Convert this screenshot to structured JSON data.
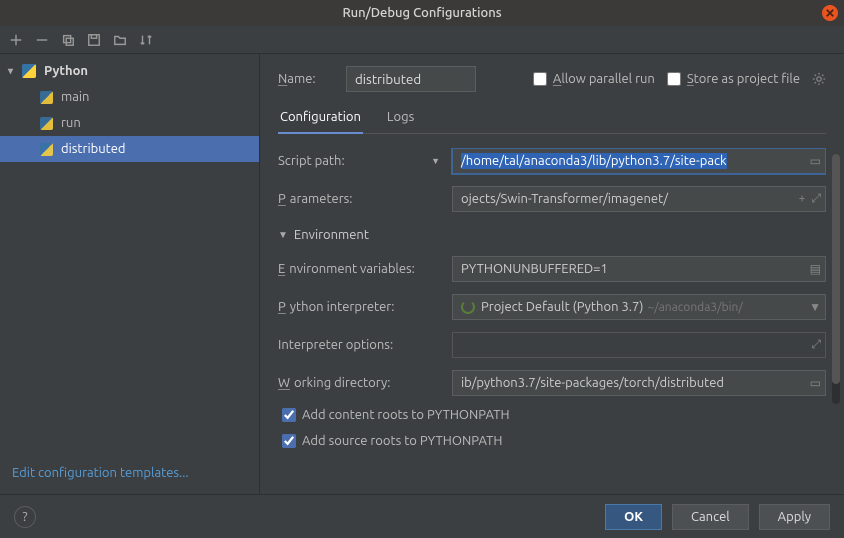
{
  "window": {
    "title": "Run/Debug Configurations"
  },
  "sidebar": {
    "root": {
      "label": "Python"
    },
    "items": [
      {
        "label": "main"
      },
      {
        "label": "run"
      },
      {
        "label": "distributed",
        "selected": true
      }
    ],
    "edit_templates": "Edit configuration templates..."
  },
  "header": {
    "name_label": "Name:",
    "name_value": "distributed",
    "allow_parallel": "Allow parallel run",
    "store_project": "Store as project file"
  },
  "tabs": {
    "configuration": "Configuration",
    "logs": "Logs"
  },
  "form": {
    "script_path_label": "Script path:",
    "script_path_value": "/home/tal/anaconda3/lib/python3.7/site-pack",
    "parameters_label": "Parameters:",
    "parameters_value": "ojects/Swin-Transformer/imagenet/",
    "env_section": "Environment",
    "env_vars_label": "Environment variables:",
    "env_vars_value": "PYTHONUNBUFFERED=1",
    "interpreter_label": "Python interpreter:",
    "interpreter_value": "Project Default (Python 3.7)",
    "interpreter_hint": "~/anaconda3/bin/",
    "interpreter_opts_label": "Interpreter options:",
    "interpreter_opts_value": "",
    "workdir_label": "Working directory:",
    "workdir_value": "ib/python3.7/site-packages/torch/distributed",
    "add_content_roots": "Add content roots to PYTHONPATH",
    "add_source_roots": "Add source roots to PYTHONPATH"
  },
  "buttons": {
    "ok": "OK",
    "cancel": "Cancel",
    "apply": "Apply",
    "help": "?"
  }
}
